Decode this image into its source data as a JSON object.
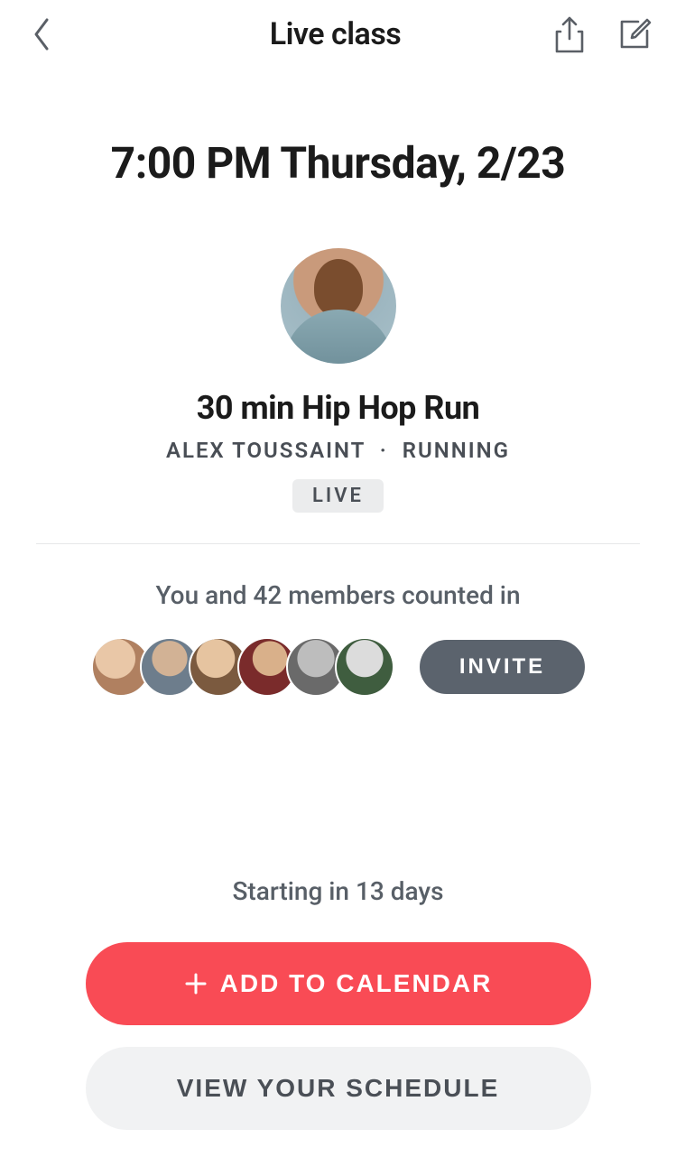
{
  "header": {
    "title": "Live class"
  },
  "class": {
    "datetime": "7:00 PM Thursday, 2/23",
    "title": "30 min Hip Hop Run",
    "instructor": "ALEX TOUSSAINT",
    "category": "RUNNING",
    "badge": "LIVE"
  },
  "members": {
    "counted_in_text": "You and 42 members counted in",
    "invite_label": "INVITE"
  },
  "footer": {
    "starting_in": "Starting in 13 days",
    "add_to_calendar": "ADD TO CALENDAR",
    "view_schedule": "VIEW YOUR SCHEDULE"
  }
}
